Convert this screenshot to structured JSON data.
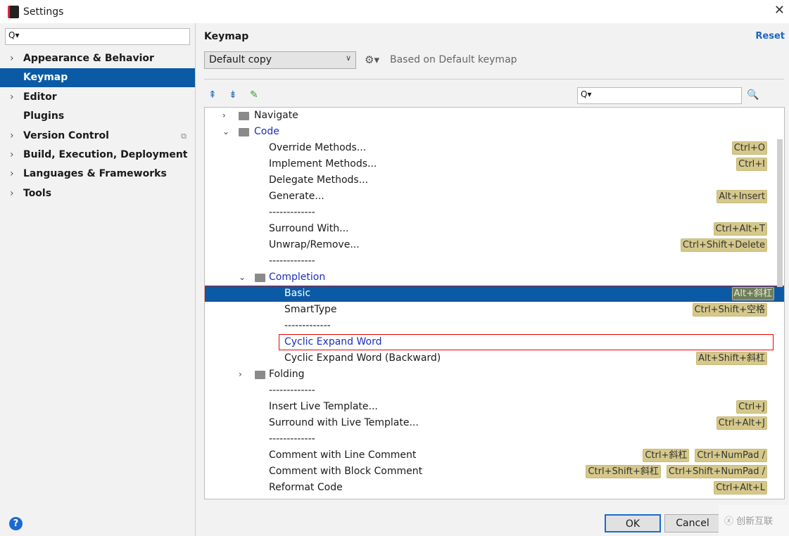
{
  "window": {
    "title": "Settings"
  },
  "sidebar": {
    "search_placeholder": "Q▾",
    "items": [
      {
        "label": "Appearance & Behavior",
        "arrow": true
      },
      {
        "label": "Keymap",
        "arrow": false,
        "selected": true
      },
      {
        "label": "Editor",
        "arrow": true
      },
      {
        "label": "Plugins",
        "arrow": false
      },
      {
        "label": "Version Control",
        "arrow": true,
        "copy": true
      },
      {
        "label": "Build, Execution, Deployment",
        "arrow": true
      },
      {
        "label": "Languages & Frameworks",
        "arrow": true
      },
      {
        "label": "Tools",
        "arrow": true
      }
    ]
  },
  "main": {
    "heading": "Keymap",
    "reset": "Reset",
    "keymap_value": "Default copy",
    "based_on": "Based on Default keymap",
    "tree_search_placeholder": "Q▾"
  },
  "tree": [
    {
      "label": "Navigate",
      "level": 0,
      "folder": true,
      "toggle": "›"
    },
    {
      "label": "Code",
      "level": 0,
      "folder": true,
      "toggle": "⌄",
      "blue": true
    },
    {
      "label": "Override Methods...",
      "level": 1,
      "shortcuts": [
        "Ctrl+O"
      ]
    },
    {
      "label": "Implement Methods...",
      "level": 1,
      "shortcuts": [
        "Ctrl+I"
      ]
    },
    {
      "label": "Delegate Methods...",
      "level": 1
    },
    {
      "label": "Generate...",
      "level": 1,
      "shortcuts": [
        "Alt+Insert"
      ]
    },
    {
      "label": "-------------",
      "level": 1
    },
    {
      "label": "Surround With...",
      "level": 1,
      "shortcuts": [
        "Ctrl+Alt+T"
      ]
    },
    {
      "label": "Unwrap/Remove...",
      "level": 1,
      "shortcuts": [
        "Ctrl+Shift+Delete"
      ]
    },
    {
      "label": "-------------",
      "level": 1
    },
    {
      "label": "Completion",
      "level": 1,
      "folder": true,
      "toggle": "⌄",
      "blue": true
    },
    {
      "label": "Basic",
      "level": 2,
      "shortcuts": [
        "Alt+斜杠"
      ],
      "selected": true,
      "boxed": true
    },
    {
      "label": "SmartType",
      "level": 2,
      "shortcuts": [
        "Ctrl+Shift+空格"
      ]
    },
    {
      "label": "-------------",
      "level": 2
    },
    {
      "label": "Cyclic Expand Word",
      "level": 2,
      "blue": true,
      "boxed": true
    },
    {
      "label": "Cyclic Expand Word (Backward)",
      "level": 2,
      "shortcuts": [
        "Alt+Shift+斜杠"
      ]
    },
    {
      "label": "Folding",
      "level": 1,
      "folder": true,
      "toggle": "›"
    },
    {
      "label": "-------------",
      "level": 1
    },
    {
      "label": "Insert Live Template...",
      "level": 1,
      "shortcuts": [
        "Ctrl+J"
      ]
    },
    {
      "label": "Surround with Live Template...",
      "level": 1,
      "shortcuts": [
        "Ctrl+Alt+J"
      ]
    },
    {
      "label": "-------------",
      "level": 1
    },
    {
      "label": "Comment with Line Comment",
      "level": 1,
      "shortcuts": [
        "Ctrl+斜杠",
        "Ctrl+NumPad /"
      ]
    },
    {
      "label": "Comment with Block Comment",
      "level": 1,
      "shortcuts": [
        "Ctrl+Shift+斜杠",
        "Ctrl+Shift+NumPad /"
      ]
    },
    {
      "label": "Reformat Code",
      "level": 1,
      "shortcuts": [
        "Ctrl+Alt+L"
      ]
    }
  ],
  "buttons": {
    "ok": "OK",
    "cancel": "Cancel",
    "help": "?"
  },
  "watermark": "创新互联"
}
